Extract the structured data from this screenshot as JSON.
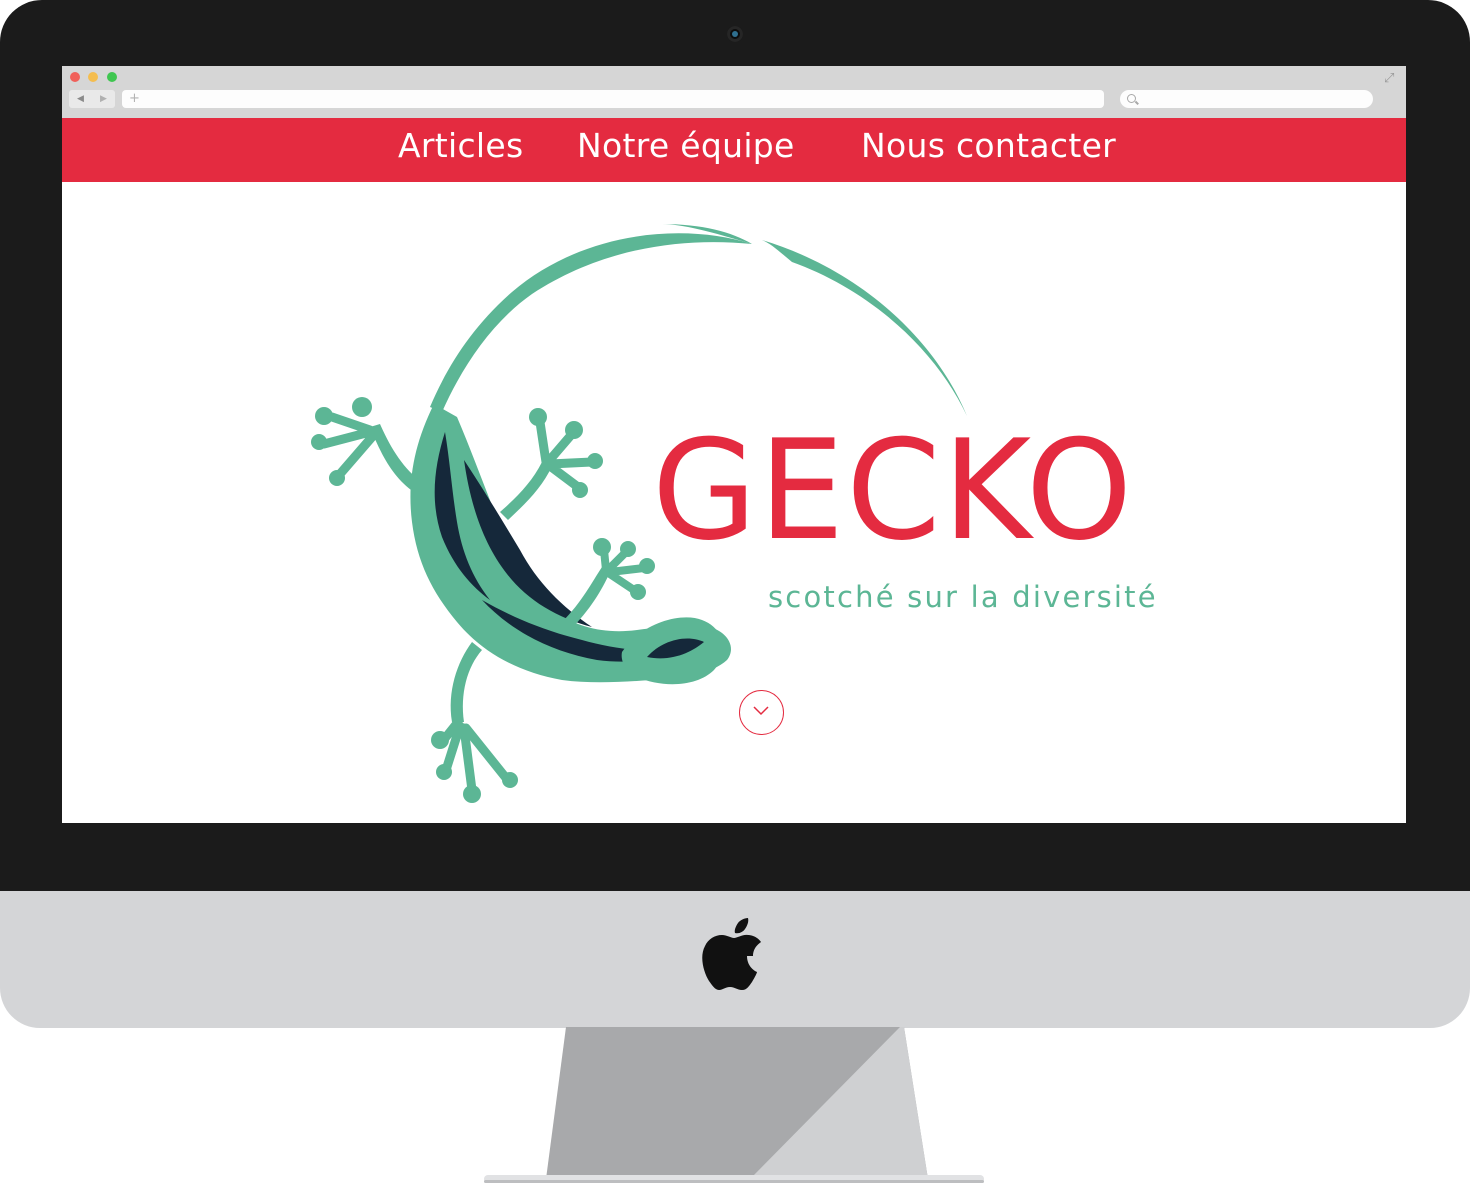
{
  "nav": {
    "items": [
      {
        "label": "Articles"
      },
      {
        "label": "Notre équipe"
      },
      {
        "label": "Nous contacter"
      }
    ]
  },
  "hero": {
    "title": "GECKO",
    "tagline": "scotché sur la diversité",
    "logo_icon": "gecko-icon",
    "scroll_icon": "chevron-down-icon"
  },
  "browser": {
    "back_icon": "back-arrow-icon",
    "forward_icon": "forward-arrow-icon",
    "new_tab_icon": "plus-icon",
    "search_icon": "search-icon",
    "fullscreen_icon": "expand-icon"
  },
  "device": {
    "logo_icon": "apple-logo-icon"
  },
  "colors": {
    "accent_red": "#e42b40",
    "gecko_green": "#5cb695",
    "gecko_dark": "#15283a",
    "bezel": "#1b1b1b",
    "chin": "#d4d5d7"
  }
}
